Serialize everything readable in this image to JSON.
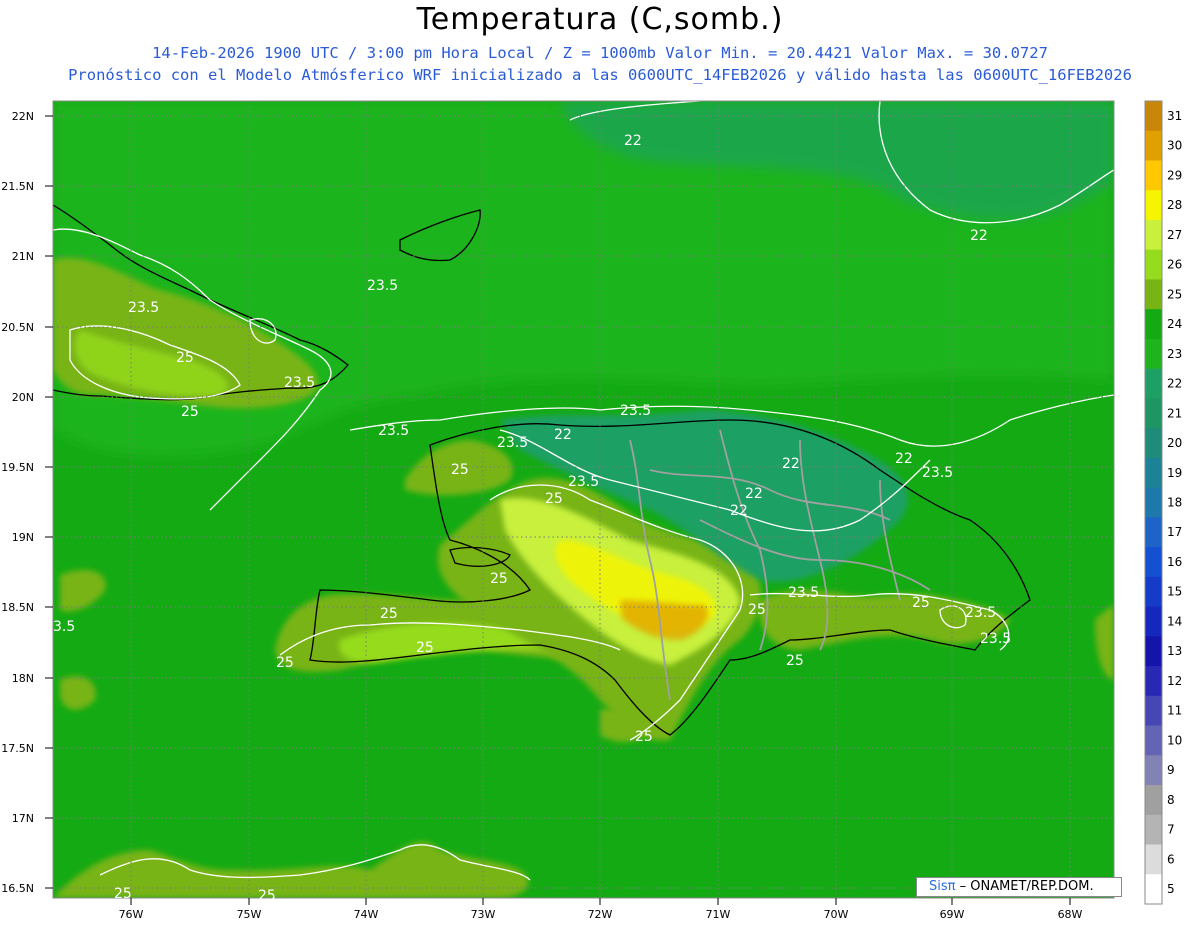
{
  "header": {
    "title": "Temperatura (C,somb.)",
    "subtitle1": "14-Feb-2026  1900 UTC / 3:00 pm Hora Local / Z = 1000mb   Valor Min. = 20.4421  Valor Max. = 30.0727",
    "subtitle2": "Pronóstico con el Modelo Atmósferico WRF inicializado a las 0600UTC_14FEB2026 y válido hasta las  0600UTC_16FEB2026"
  },
  "axes": {
    "lat_labels": [
      "22N",
      "21.5N",
      "21N",
      "20.5N",
      "20N",
      "19.5N",
      "19N",
      "18.5N",
      "18N",
      "17.5N",
      "17N",
      "16.5N"
    ],
    "lon_labels": [
      "76W",
      "75W",
      "74W",
      "73W",
      "72W",
      "71W",
      "70W",
      "69W",
      "68W"
    ]
  },
  "contour_labels": [
    "22",
    "22",
    "23.5",
    "23.5",
    "25",
    "23.5",
    "25",
    "23.5",
    "23.5",
    "22",
    "23.5",
    "25",
    "23.5",
    "22",
    "22",
    "22",
    "22",
    "23.5",
    "25",
    "25",
    "25",
    "25",
    "23.5",
    "25",
    "25",
    "23.5",
    "23.5",
    "25",
    "25",
    "25",
    "25",
    "25",
    "3.5"
  ],
  "colorbar": {
    "levels": [
      "31",
      "30",
      "29",
      "28",
      "27",
      "26",
      "25",
      "24",
      "23",
      "22",
      "21",
      "20",
      "19",
      "18",
      "17",
      "16",
      "15",
      "14",
      "13",
      "12",
      "11",
      "10",
      "9",
      "8",
      "7",
      "6",
      "5"
    ],
    "colors": [
      "#c8860a",
      "#e0a000",
      "#ffc800",
      "#f5f500",
      "#c8f03c",
      "#96dc1e",
      "#78b414",
      "#14aa14",
      "#1eb41e",
      "#1ea064",
      "#1e9664",
      "#1e8c78",
      "#1e8296",
      "#1e78aa",
      "#1e64c8",
      "#1450d2",
      "#143cc8",
      "#1428be",
      "#1414aa",
      "#2828b4",
      "#4646b4",
      "#6464b4",
      "#8282b4",
      "#a0a0a0",
      "#b4b4b4",
      "#dcdcdc",
      "#ffffff"
    ]
  },
  "credit": {
    "logo": "Sisπ",
    "org": "– ONAMET/REP.DOM."
  }
}
